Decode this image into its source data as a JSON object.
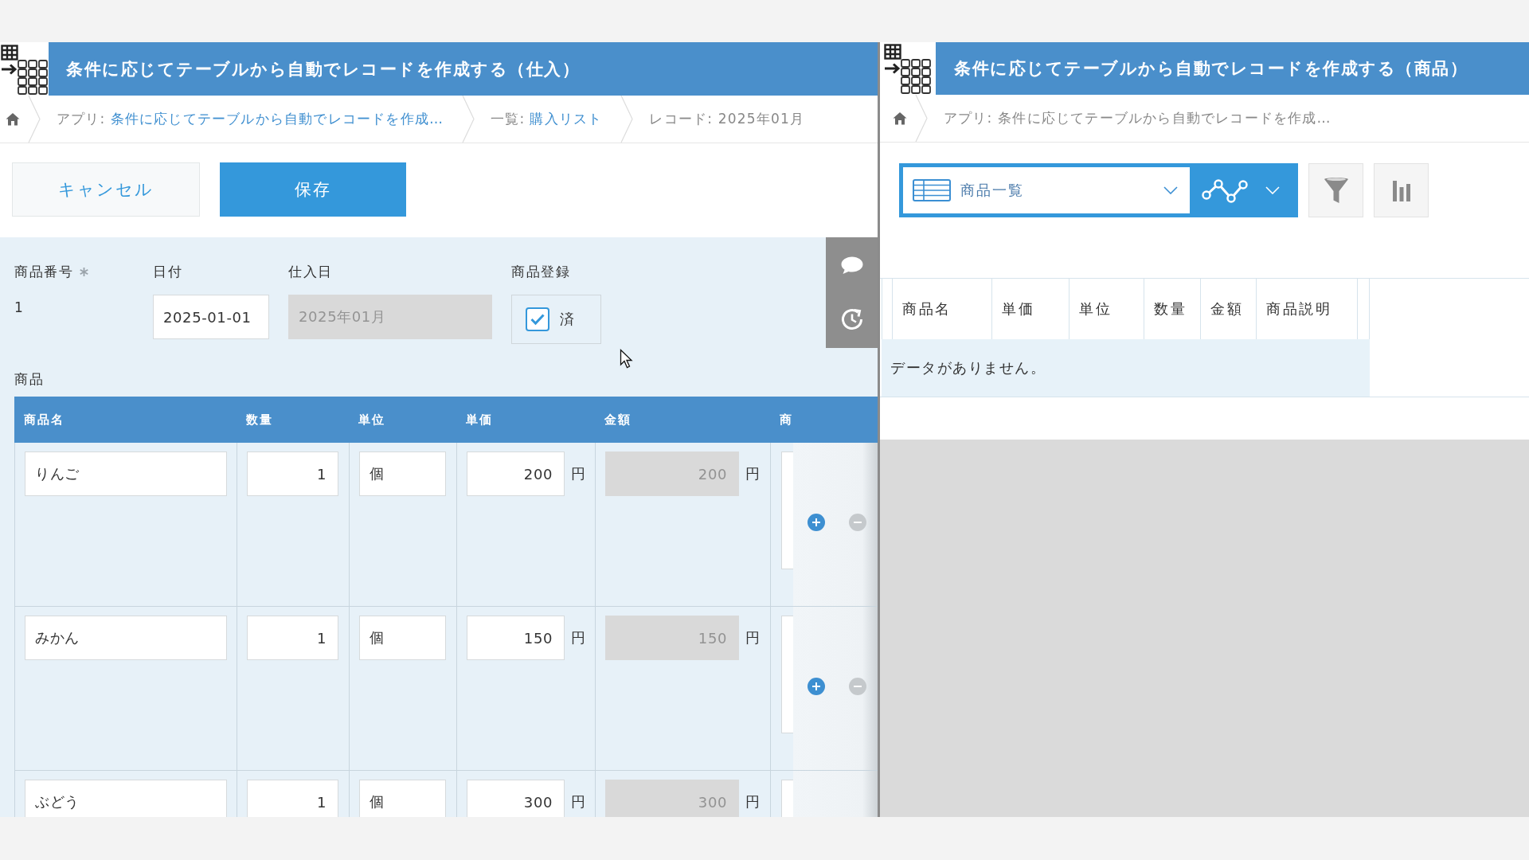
{
  "left_window": {
    "title": "条件に応じてテーブルから自動でレコードを作成する（仕入）",
    "breadcrumb": [
      {
        "label": "アプリ:",
        "link": "条件に応じてテーブルから自動でレコードを作成…"
      },
      {
        "label": "一覧:",
        "link": "購入リスト"
      },
      {
        "label": "レコード: 2025年01月"
      }
    ],
    "buttons": [
      {
        "label": "キャンセル",
        "kind": "secondary"
      },
      {
        "label": "保存",
        "kind": "primary"
      }
    ],
    "fields": [
      {
        "label": "商品番号",
        "required": true,
        "kind": "static",
        "value": "1"
      },
      {
        "label": "日付",
        "required": false,
        "kind": "date",
        "value": "2025-01-01"
      },
      {
        "label": "仕入日",
        "required": false,
        "kind": "disabled",
        "value": "2025年01月"
      },
      {
        "label": "商品登録",
        "required": false,
        "kind": "checkbox",
        "options": [
          {
            "label": "済",
            "checked": true
          }
        ]
      }
    ],
    "subtable": {
      "label": "商品",
      "columns": [
        "商品名",
        "数量",
        "単位",
        "単価",
        "金額",
        "商"
      ],
      "rows": [
        {
          "cells": [
            {
              "kind": "text",
              "value": "りんご"
            },
            {
              "kind": "number",
              "value": "1"
            },
            {
              "kind": "text",
              "value": "個"
            },
            {
              "kind": "number",
              "value": "200",
              "suffix": "円"
            },
            {
              "kind": "calc",
              "value": "200",
              "suffix": "円"
            }
          ]
        },
        {
          "cells": [
            {
              "kind": "text",
              "value": "みかん"
            },
            {
              "kind": "number",
              "value": "1"
            },
            {
              "kind": "text",
              "value": "個"
            },
            {
              "kind": "number",
              "value": "150",
              "suffix": "円"
            },
            {
              "kind": "calc",
              "value": "150",
              "suffix": "円"
            }
          ]
        },
        {
          "cells": [
            {
              "kind": "text",
              "value": "ぶどう"
            },
            {
              "kind": "number",
              "value": "1"
            },
            {
              "kind": "text",
              "value": "個"
            },
            {
              "kind": "number",
              "value": "300",
              "suffix": "円"
            },
            {
              "kind": "calc",
              "value": "300",
              "suffix": "円"
            }
          ]
        }
      ]
    }
  },
  "right_window": {
    "title": "条件に応じてテーブルから自動でレコードを作成する（商品）",
    "breadcrumb": [
      {
        "label": "アプリ: 条件に応じてテーブルから自動でレコードを作成…"
      }
    ],
    "view_selector": {
      "value": "商品一覧"
    },
    "table": {
      "columns": [
        "商品名",
        "単価",
        "単位",
        "数量",
        "金額",
        "商品説明"
      ],
      "empty_message": "データがありません。"
    }
  }
}
